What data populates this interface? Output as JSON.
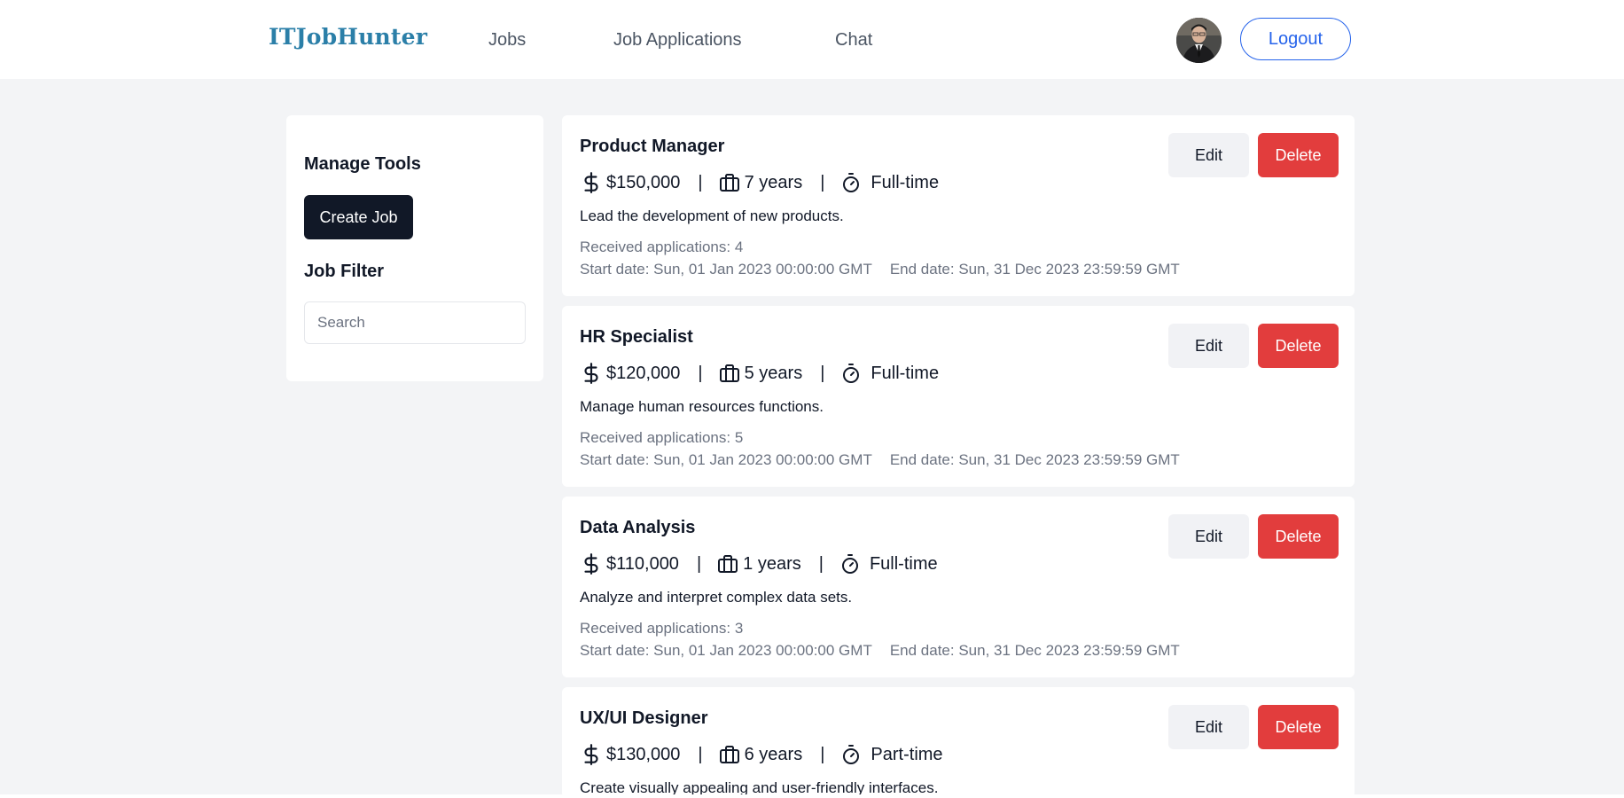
{
  "header": {
    "brand": "ITJobHunter",
    "nav": [
      "Jobs",
      "Job Applications",
      "Chat"
    ],
    "logout_label": "Logout",
    "brand_color": "#2b7fa8",
    "accent_color": "#2563eb"
  },
  "sidebar": {
    "manage_title": "Manage Tools",
    "create_label": "Create Job",
    "filter_title": "Job Filter",
    "search_placeholder": "Search"
  },
  "jobs": [
    {
      "title": "Product Manager",
      "salary": "$150,000",
      "experience": "7 years",
      "type": "Full-time",
      "description": "Lead the development of new products.",
      "received": "Received applications: 4",
      "start": "Start date: Sun, 01 Jan 2023 00:00:00 GMT",
      "end": "End date: Sun, 31 Dec 2023 23:59:59 GMT"
    },
    {
      "title": "HR Specialist",
      "salary": "$120,000",
      "experience": "5 years",
      "type": "Full-time",
      "description": "Manage human resources functions.",
      "received": "Received applications: 5",
      "start": "Start date: Sun, 01 Jan 2023 00:00:00 GMT",
      "end": "End date: Sun, 31 Dec 2023 23:59:59 GMT"
    },
    {
      "title": "Data Analysis",
      "salary": "$110,000",
      "experience": "1 years",
      "type": "Full-time",
      "description": "Analyze and interpret complex data sets.",
      "received": "Received applications: 3",
      "start": "Start date: Sun, 01 Jan 2023 00:00:00 GMT",
      "end": "End date: Sun, 31 Dec 2023 23:59:59 GMT"
    },
    {
      "title": "UX/UI Designer",
      "salary": "$130,000",
      "experience": "6 years",
      "type": "Part-time",
      "description": "Create visually appealing and user-friendly interfaces."
    }
  ],
  "actions": {
    "edit_label": "Edit",
    "delete_label": "Delete",
    "separator": "|"
  },
  "colors": {
    "create_button": "#111827",
    "delete_button": "#e23d3d",
    "edit_button": "#f1f2f5",
    "page_background": "#f3f4f6"
  },
  "icons": {
    "salary": "dollar-icon",
    "experience": "briefcase-icon",
    "type": "stopwatch-icon"
  }
}
